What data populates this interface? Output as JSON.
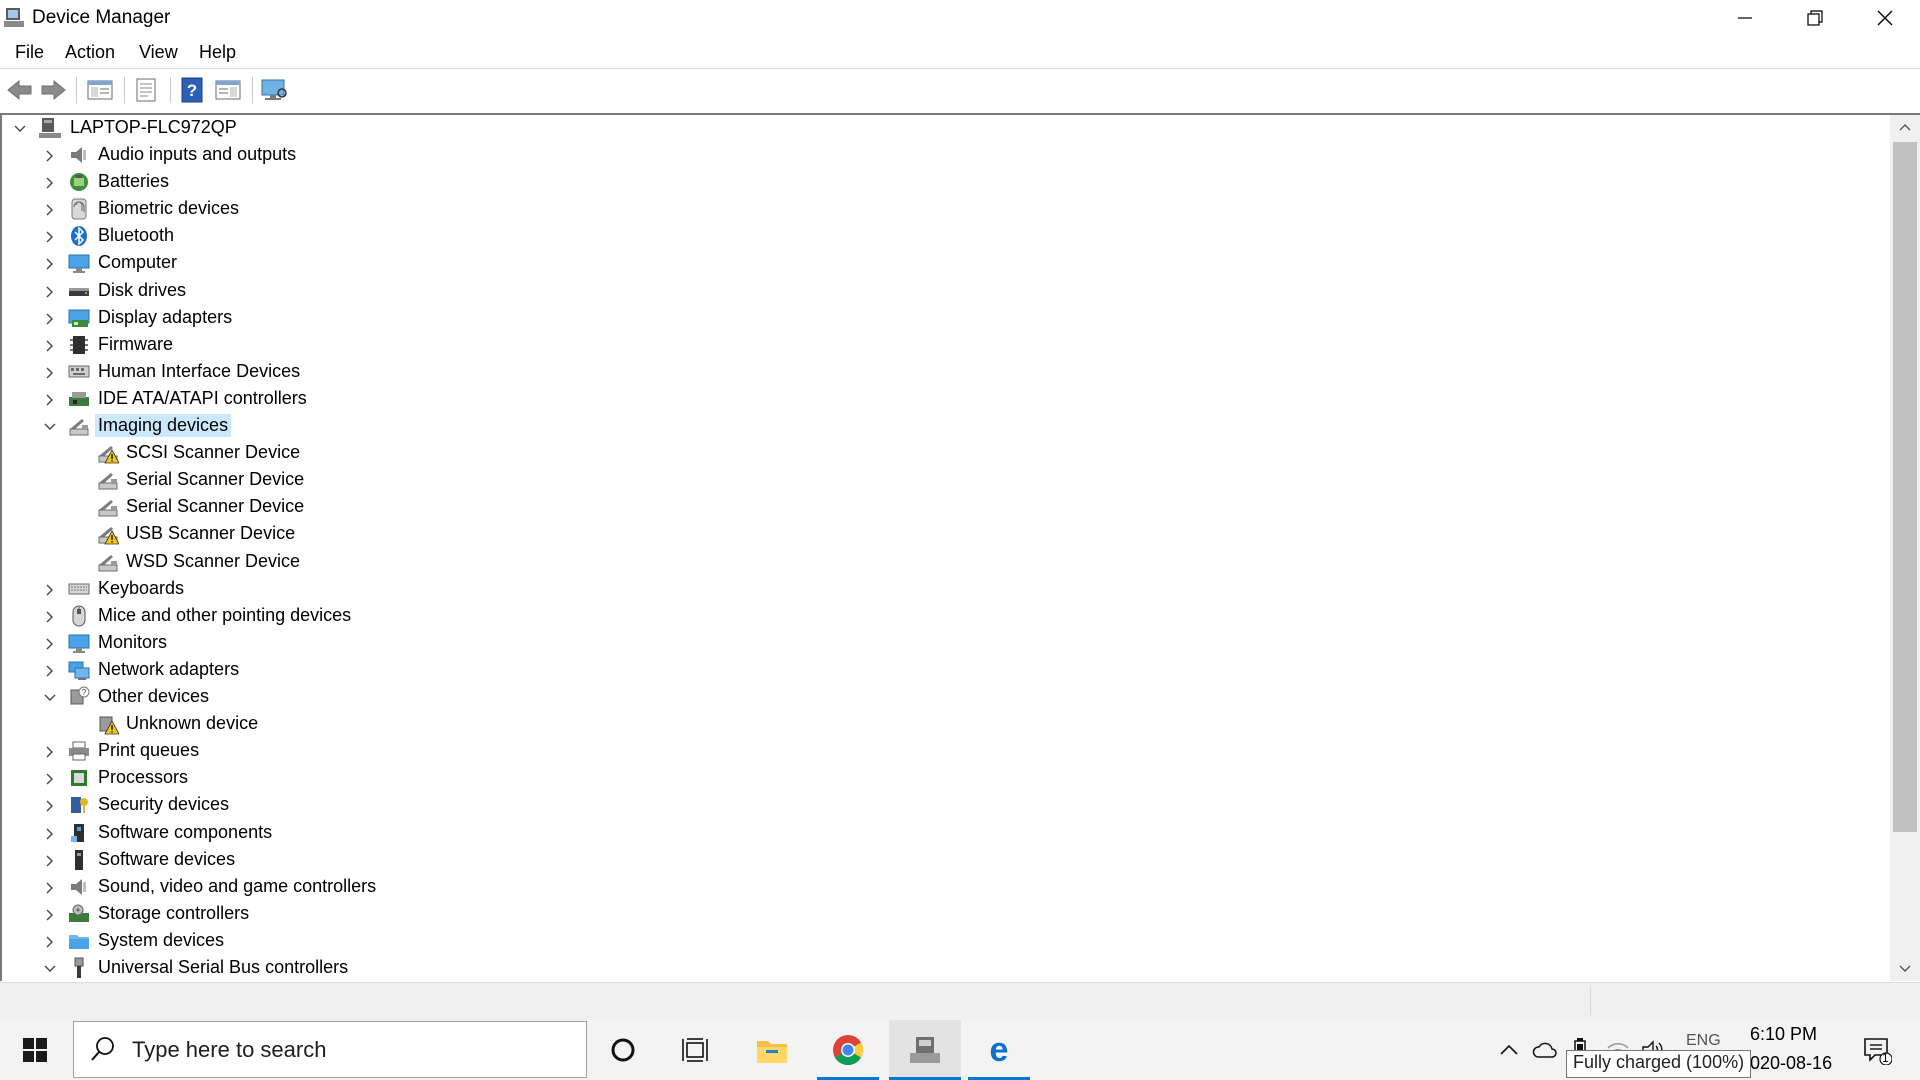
{
  "window": {
    "title": "Device Manager",
    "controls": {
      "minimize": "minimize",
      "restore": "restore",
      "close": "close"
    }
  },
  "menu": [
    "File",
    "Action",
    "View",
    "Help"
  ],
  "toolbar": {
    "buttons": [
      "back-icon",
      "forward-icon",
      "show-hide-tree-icon",
      "properties-icon",
      "help-icon",
      "action-pane-icon",
      "scan-hardware-icon"
    ]
  },
  "tree": {
    "root": "LAPTOP-FLC972QP",
    "items": [
      {
        "label": "Audio inputs and outputs",
        "icon": "speaker-icon",
        "expanded": false
      },
      {
        "label": "Batteries",
        "icon": "battery-icon",
        "expanded": false
      },
      {
        "label": "Biometric devices",
        "icon": "fingerprint-icon",
        "expanded": false
      },
      {
        "label": "Bluetooth",
        "icon": "bluetooth-icon",
        "expanded": false
      },
      {
        "label": "Computer",
        "icon": "monitor-icon",
        "expanded": false
      },
      {
        "label": "Disk drives",
        "icon": "disk-icon",
        "expanded": false
      },
      {
        "label": "Display adapters",
        "icon": "display-adapter-icon",
        "expanded": false
      },
      {
        "label": "Firmware",
        "icon": "chip-icon",
        "expanded": false
      },
      {
        "label": "Human Interface Devices",
        "icon": "hid-icon",
        "expanded": false
      },
      {
        "label": "IDE ATA/ATAPI controllers",
        "icon": "ide-controller-icon",
        "expanded": false
      },
      {
        "label": "Imaging devices",
        "icon": "scanner-icon",
        "expanded": true,
        "selected": true
      },
      {
        "label": "SCSI Scanner Device",
        "icon": "scanner-warning-icon",
        "child": true
      },
      {
        "label": "Serial Scanner Device",
        "icon": "scanner-icon",
        "child": true
      },
      {
        "label": "Serial Scanner Device",
        "icon": "scanner-icon",
        "child": true
      },
      {
        "label": "USB Scanner Device",
        "icon": "scanner-warning-icon",
        "child": true
      },
      {
        "label": "WSD Scanner Device",
        "icon": "scanner-icon",
        "child": true
      },
      {
        "label": "Keyboards",
        "icon": "keyboard-icon",
        "expanded": false
      },
      {
        "label": "Mice and other pointing devices",
        "icon": "mouse-icon",
        "expanded": false
      },
      {
        "label": "Monitors",
        "icon": "monitor-icon",
        "expanded": false
      },
      {
        "label": "Network adapters",
        "icon": "network-icon",
        "expanded": false
      },
      {
        "label": "Other devices",
        "icon": "unknown-device-icon",
        "expanded": true
      },
      {
        "label": "Unknown device",
        "icon": "unknown-warning-icon",
        "child": true
      },
      {
        "label": "Print queues",
        "icon": "printer-icon",
        "expanded": false
      },
      {
        "label": "Processors",
        "icon": "processor-icon",
        "expanded": false
      },
      {
        "label": "Security devices",
        "icon": "security-key-icon",
        "expanded": false
      },
      {
        "label": "Software components",
        "icon": "software-component-icon",
        "expanded": false
      },
      {
        "label": "Software devices",
        "icon": "software-device-icon",
        "expanded": false
      },
      {
        "label": "Sound, video and game controllers",
        "icon": "speaker-icon",
        "expanded": false
      },
      {
        "label": "Storage controllers",
        "icon": "storage-controller-icon",
        "expanded": false
      },
      {
        "label": "System devices",
        "icon": "system-folder-icon",
        "expanded": false
      },
      {
        "label": "Universal Serial Bus controllers",
        "icon": "usb-icon",
        "expanded": true
      }
    ]
  },
  "taskbar": {
    "search_placeholder": "Type here to search",
    "time": "6:10 PM",
    "date": "2020-08-16",
    "language": "ENG",
    "notification_count": "1",
    "battery_tooltip": "Fully charged (100%)"
  },
  "colors": {
    "selection": "#cce8ff",
    "accent": "#0078d7",
    "warning": "#f2c811"
  }
}
